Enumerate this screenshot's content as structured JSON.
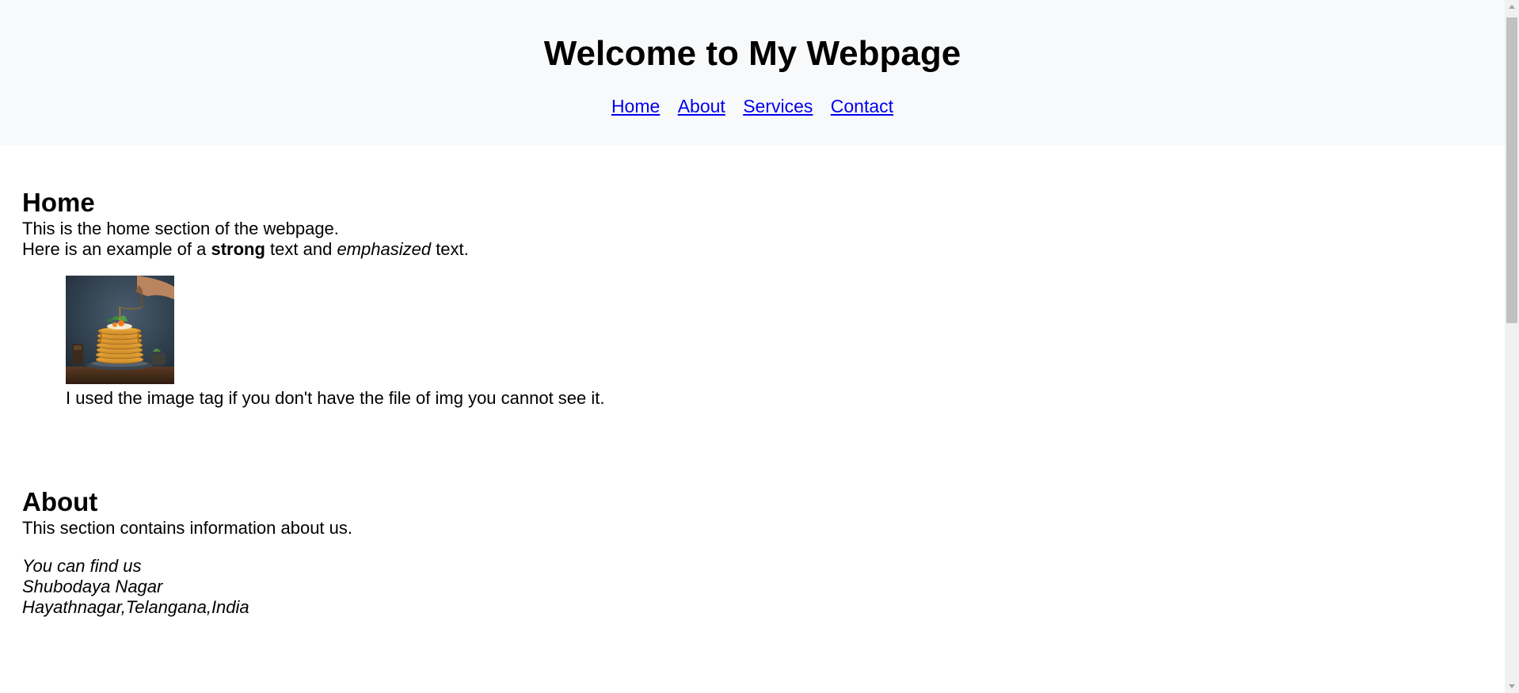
{
  "header": {
    "title": "Welcome to My Webpage",
    "nav": [
      "Home",
      "About",
      "Services",
      "Contact"
    ]
  },
  "home": {
    "heading": "Home",
    "text1": "This is the home section of the webpage.",
    "text2_prefix": "Here is an example of a ",
    "text2_strong": "strong",
    "text2_middle": " text and ",
    "text2_em": "emphasized",
    "text2_suffix": " text.",
    "image_caption": "I used the image tag if you don't have the file of img you cannot see it."
  },
  "about": {
    "heading": "About",
    "text1": "This section contains information about us.",
    "address": [
      "You can find us",
      "Shubodaya Nagar",
      "Hayathnagar,Telangana,India"
    ]
  },
  "colors": {
    "header_bg": "#f8f9fa",
    "link": "#0000ee",
    "scrollbar_thumb": "#c1c1c1"
  }
}
